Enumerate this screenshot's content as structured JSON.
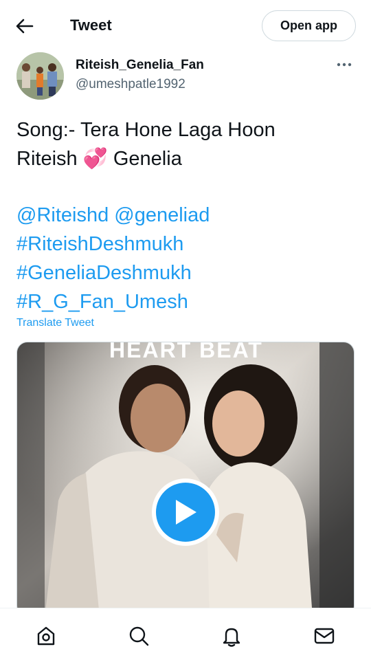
{
  "header": {
    "title": "Tweet",
    "open_app_label": "Open app",
    "back_icon": "arrow-left-icon"
  },
  "author": {
    "name": "Riteish_Genelia_Fan",
    "handle": "@umeshpatle1992",
    "more_icon": "more-horizontal-icon"
  },
  "tweet": {
    "line1": "Song:- Tera Hone Laga Hoon",
    "line2_a": "Riteish ",
    "emoji": "💞",
    "line2_b": " Genelia",
    "mentions": "@Riteishd @geneliad",
    "hashtags": [
      "#RiteishDeshmukh",
      "#GeneliaDeshmukh",
      "#R_G_Fan_Umesh"
    ],
    "translate_label": "Translate Tweet"
  },
  "media": {
    "overlay_text": "HEART BEAT",
    "play_icon": "play-icon"
  },
  "bottom_nav": {
    "items": [
      "home-icon",
      "search-icon",
      "notifications-bell-icon",
      "messages-envelope-icon"
    ]
  },
  "colors": {
    "accent": "#1d9bf0",
    "text": "#0f1419",
    "secondary": "#536471"
  }
}
